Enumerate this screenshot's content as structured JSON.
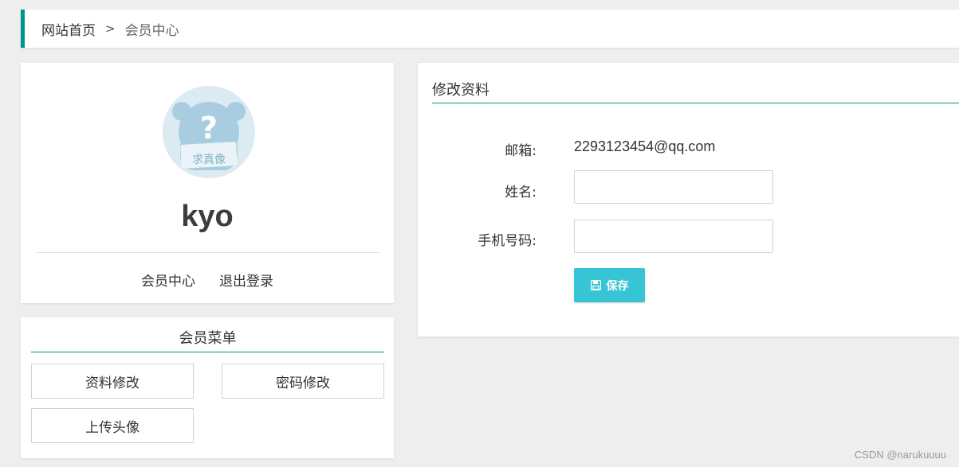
{
  "breadcrumb": {
    "home": "网站首页",
    "separator": ">",
    "current": "会员中心"
  },
  "profile": {
    "username": "kyo",
    "avatar_caption": "求真像",
    "avatar_symbol": "?",
    "links": {
      "member_center": "会员中心",
      "logout": "退出登录"
    }
  },
  "member_menu": {
    "title": "会员菜单",
    "items": [
      {
        "label": "资料修改"
      },
      {
        "label": "密码修改"
      },
      {
        "label": "上传头像"
      }
    ]
  },
  "edit_profile": {
    "title": "修改资料",
    "email_label": "邮箱:",
    "email_value": "2293123454@qq.com",
    "name_label": "姓名:",
    "name_value": "",
    "phone_label": "手机号码:",
    "phone_value": "",
    "save_label": "保存",
    "save_icon": "floppy-disk-icon"
  },
  "watermark": "CSDN @narukuuuu",
  "colors": {
    "accent": "#009688",
    "save_button": "#37c4d4",
    "background": "#eeeeee"
  }
}
